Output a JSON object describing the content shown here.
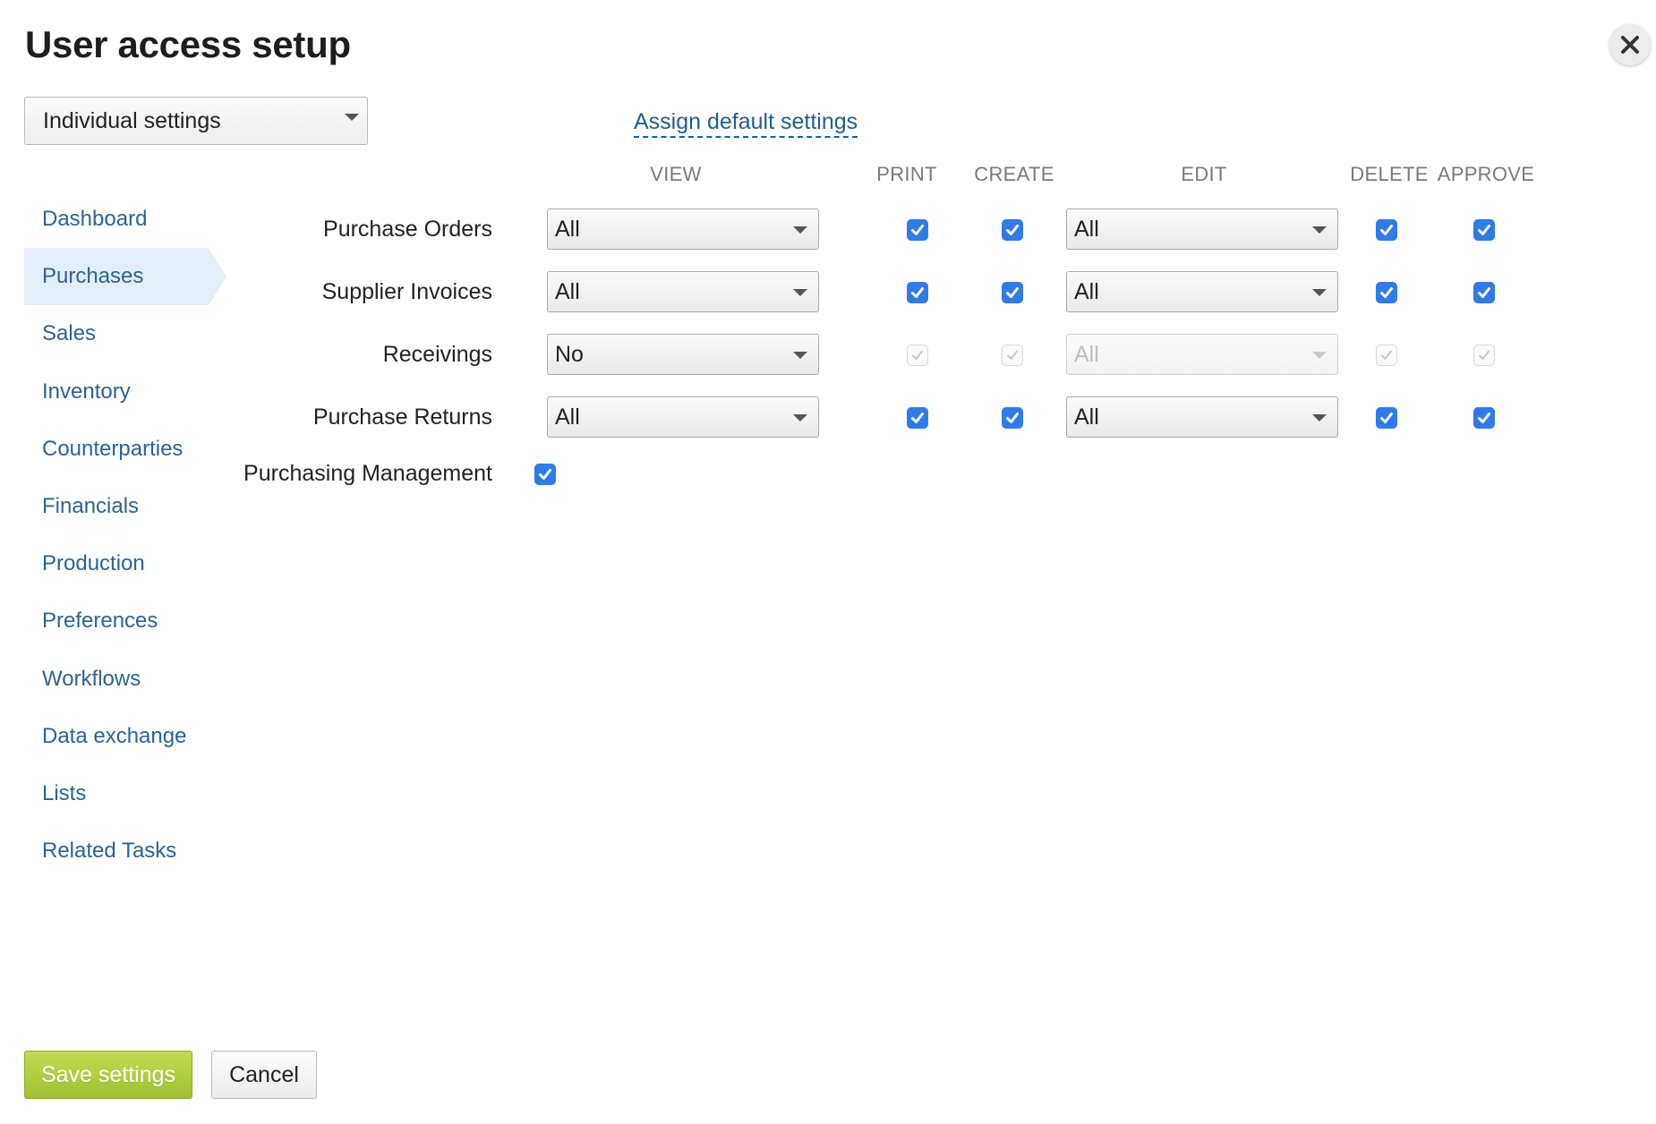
{
  "dialog": {
    "title": "User access setup",
    "close_icon": "close-icon"
  },
  "mode_select": {
    "value": "Individual settings"
  },
  "assign_default_link": "Assign default settings",
  "columns": {
    "view": "VIEW",
    "print": "PRINT",
    "create": "CREATE",
    "edit": "EDIT",
    "delete": "DELETE",
    "approve": "APPROVE"
  },
  "sidebar": {
    "active": "Purchases",
    "items": [
      {
        "label": "Dashboard"
      },
      {
        "label": "Purchases"
      },
      {
        "label": "Sales"
      },
      {
        "label": "Inventory"
      },
      {
        "label": "Counterparties"
      },
      {
        "label": "Financials"
      },
      {
        "label": "Production"
      },
      {
        "label": "Preferences"
      },
      {
        "label": "Workflows"
      },
      {
        "label": "Data exchange"
      },
      {
        "label": "Lists"
      },
      {
        "label": "Related Tasks"
      }
    ]
  },
  "permissions": {
    "rows": [
      {
        "label": "Purchase Orders",
        "view": "All",
        "print": true,
        "create": true,
        "edit": "All",
        "delete": true,
        "approve": true,
        "enabled": true
      },
      {
        "label": "Supplier Invoices",
        "view": "All",
        "print": true,
        "create": true,
        "edit": "All",
        "delete": true,
        "approve": true,
        "enabled": true
      },
      {
        "label": "Receivings",
        "view": "No",
        "print": true,
        "create": true,
        "edit": "All",
        "delete": true,
        "approve": true,
        "enabled": false
      },
      {
        "label": "Purchase Returns",
        "view": "All",
        "print": true,
        "create": true,
        "edit": "All",
        "delete": true,
        "approve": true,
        "enabled": true
      }
    ],
    "management": {
      "label": "Purchasing Management",
      "checked": true
    }
  },
  "footer": {
    "save_label": "Save settings",
    "cancel_label": "Cancel"
  },
  "colors": {
    "link": "#2d6394",
    "checkbox": "#2f7bea",
    "save_button": "#a9c83c",
    "active_nav_bg": "#e4eef8"
  }
}
